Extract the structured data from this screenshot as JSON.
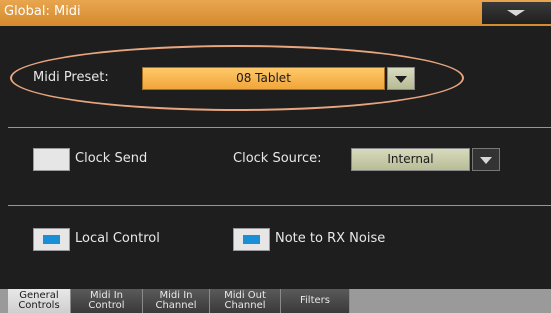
{
  "title_bar": {
    "title": "Global: Midi",
    "menu_icon": "chevron-down-icon"
  },
  "preset": {
    "label": "Midi Preset:",
    "value": "08 Tablet"
  },
  "clock": {
    "send_label": "Clock Send",
    "send_checked": false,
    "source_label": "Clock Source:",
    "source_value": "Internal"
  },
  "local": {
    "control_label": "Local Control",
    "control_checked": true,
    "note_rx_label": "Note to RX Noise",
    "note_rx_checked": true
  },
  "tabs": [
    {
      "line1": "General",
      "line2": "Controls",
      "active": true
    },
    {
      "line1": "Midi In",
      "line2": "Control",
      "active": false
    },
    {
      "line1": "Midi In",
      "line2": "Channel",
      "active": false
    },
    {
      "line1": "Midi Out",
      "line2": "Channel",
      "active": false
    },
    {
      "line1": "Filters",
      "line2": "",
      "active": false
    }
  ],
  "colors": {
    "accent": "#d58a2e",
    "field_orange": "#f7b24a",
    "checkbox_blue": "#1a8fd6"
  }
}
